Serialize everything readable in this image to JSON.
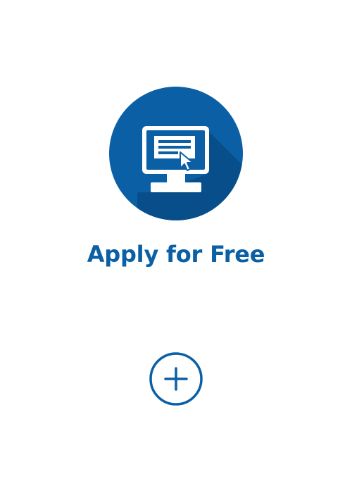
{
  "feature": {
    "title": "Apply for Free",
    "icon": "computer-application-icon",
    "expand_icon": "plus-circle-icon"
  },
  "colors": {
    "brand_blue": "#0b5fa5",
    "shadow_blue": "#084d87",
    "background": "#ffffff"
  }
}
